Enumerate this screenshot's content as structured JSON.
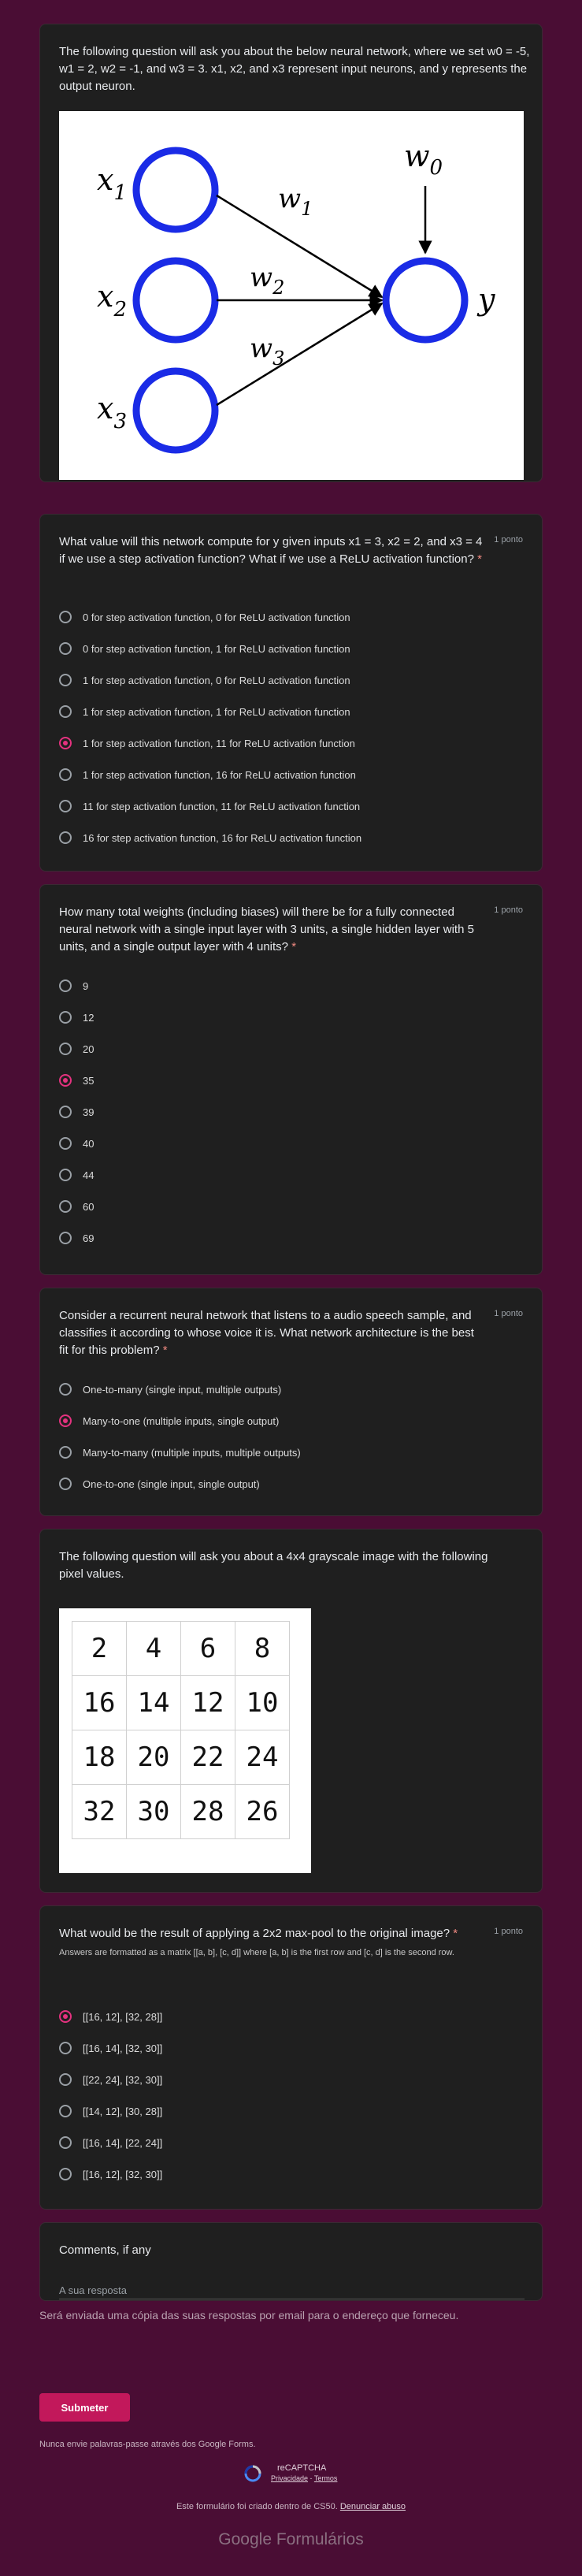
{
  "intro": {
    "text": "The following question will ask you about the below neural network, where we set w0 = -5, w1 = 2, w2 = -1, and w3 = 3. x1, x2, and x3 represent input neurons, and y represents the output neuron."
  },
  "diagram": {
    "inputs": [
      "x",
      "x",
      "x"
    ],
    "input_subs": [
      "1",
      "2",
      "3"
    ],
    "weights": [
      "w",
      "w",
      "w"
    ],
    "weight_subs": [
      "1",
      "2",
      "3"
    ],
    "bias": "w",
    "bias_sub": "0",
    "output": "y",
    "circle_color": "#1a2be6"
  },
  "q1": {
    "text": "What value will this network compute for y given inputs x1 = 3, x2 = 2, and x3 = 4 if we use a step activation function? What if we use a ReLU activation function?",
    "required": "*",
    "points": "1 ponto",
    "options": [
      "0 for step activation function, 0 for ReLU activation function",
      "0 for step activation function, 1 for ReLU activation function",
      "1 for step activation function, 0 for ReLU activation function",
      "1 for step activation function, 1 for ReLU activation function",
      "1 for step activation function, 11 for ReLU activation function",
      "1 for step activation function, 16 for ReLU activation function",
      "11 for step activation function, 11 for ReLU activation function",
      "16 for step activation function, 16 for ReLU activation function"
    ],
    "selected": 4
  },
  "q2": {
    "text": "How many total weights (including biases) will there be for a fully connected neural network with a single input layer with 3 units, a single hidden layer with 5 units, and a single output layer with 4 units?",
    "required": "*",
    "points": "1 ponto",
    "options": [
      "9",
      "12",
      "20",
      "35",
      "39",
      "40",
      "44",
      "60",
      "69"
    ],
    "selected": 3
  },
  "q3": {
    "text": "Consider a recurrent neural network that listens to a audio speech sample, and classifies it according to whose voice it is. What network architecture is the best fit for this problem?",
    "required": "*",
    "points": "1 ponto",
    "options": [
      "One-to-many (single input, multiple outputs)",
      "Many-to-one (multiple inputs, single output)",
      "Many-to-many (multiple inputs, multiple outputs)",
      "One-to-one (single input, single output)"
    ],
    "selected": 1
  },
  "intro2": {
    "text": "The following question will ask you about a 4x4 grayscale image with the following pixel values."
  },
  "pixel_grid": [
    [
      "2",
      "4",
      "6",
      "8"
    ],
    [
      "16",
      "14",
      "12",
      "10"
    ],
    [
      "18",
      "20",
      "22",
      "24"
    ],
    [
      "32",
      "30",
      "28",
      "26"
    ]
  ],
  "q4": {
    "text": "What would be the result of applying a 2x2 max-pool to the original image?",
    "required": "*",
    "points": "1 ponto",
    "description": "Answers are formatted as a matrix [[a, b], [c, d]] where [a, b] is the first row and [c, d] is the second row.",
    "options": [
      "[[16, 12], [32, 28]]",
      "[[16, 14], [32, 30]]",
      "[[22, 24], [32, 30]]",
      "[[14, 12], [30, 28]]",
      "[[16, 14], [22, 24]]",
      "[[16, 12], [32, 30]]"
    ],
    "selected": 0
  },
  "comments": {
    "label": "Comments, if any",
    "placeholder": "A sua resposta"
  },
  "footer": {
    "copy_note": "Será enviada uma cópia das suas respostas por email para o endereço que forneceu.",
    "submit_label": "Submeter",
    "password_note": "Nunca envie palavras-passe através dos Google Forms.",
    "recaptcha_label": "reCAPTCHA",
    "privacy_link": "Privacidade",
    "terms_link": "Termos",
    "created_note": "Este formulário foi criado dentro de CS50.",
    "report_link": "Denunciar abuso",
    "brand": "Google Formulários"
  },
  "colors": {
    "background": "#4a0d34",
    "card": "#1f1f1f",
    "accent": "#e4327f",
    "submit": "#c2185b"
  }
}
